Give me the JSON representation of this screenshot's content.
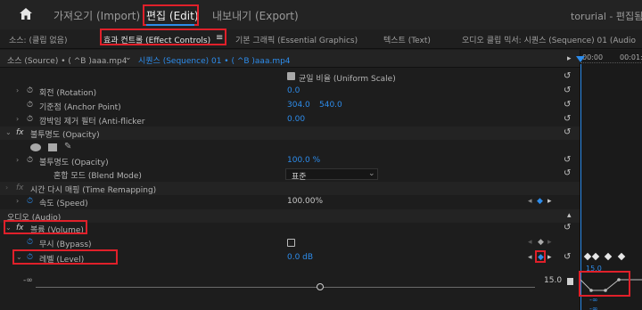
{
  "menubar": {
    "home_icon": "home-icon",
    "import": "가져오기 (Import)",
    "edit": "편집 (Edit)",
    "export": "내보내기 (Export)",
    "project": "torurial - 편집됨"
  },
  "tabs": {
    "source_clip": "소스: (클립 없음)",
    "effect_controls": "효과 컨트롤 (Effect Controls)",
    "menu_icon": "≡",
    "essential_graphics": "기본 그래픽 (Essential Graphics)",
    "text": "텍스트 (Text)",
    "audio_mixer": "오디오 클립 믹서: 시퀀스 (Sequence) 01 (Audio"
  },
  "source_bar": {
    "source": "소스 (Source) • ( ^B )aaa.mp4",
    "sequence": "시퀀스 (Sequence) 01 • ( ^B )aaa.mp4",
    "play_icon": "▸"
  },
  "timeline": {
    "tc_start": "00:00",
    "tc_next": "00:01:0",
    "level_top": "15.0",
    "level_bottom": "-∞",
    "level_top2": "-∞"
  },
  "rows": {
    "uniform_scale": "균일 비율 (Uniform Scale)",
    "rotation": "회전 (Rotation)",
    "rotation_val": "0.0",
    "anchor": "기준점 (Anchor Point)",
    "anchor_x": "304.0",
    "anchor_y": "540.0",
    "antiflicker": "깜박임 제거 필터 (Anti-flicker",
    "antiflicker_val": "0.00",
    "opacity_section": "불투명도 (Opacity)",
    "opacity": "불투명도 (Opacity)",
    "opacity_val": "100.0 %",
    "blend": "혼합 모드 (Blend Mode)",
    "blend_val": "표준",
    "time_remap": "시간 다시 매핑 (Time Remapping)",
    "speed": "속도 (Speed)",
    "speed_val": "100.00%",
    "audio_header": "오디오 (Audio)",
    "volume": "볼륨 (Volume)",
    "bypass": "무시 (Bypass)",
    "level": "레벨 (Level)",
    "level_val": "0.0 dB",
    "level_scale": "15.0",
    "slider_min": "-∞"
  }
}
